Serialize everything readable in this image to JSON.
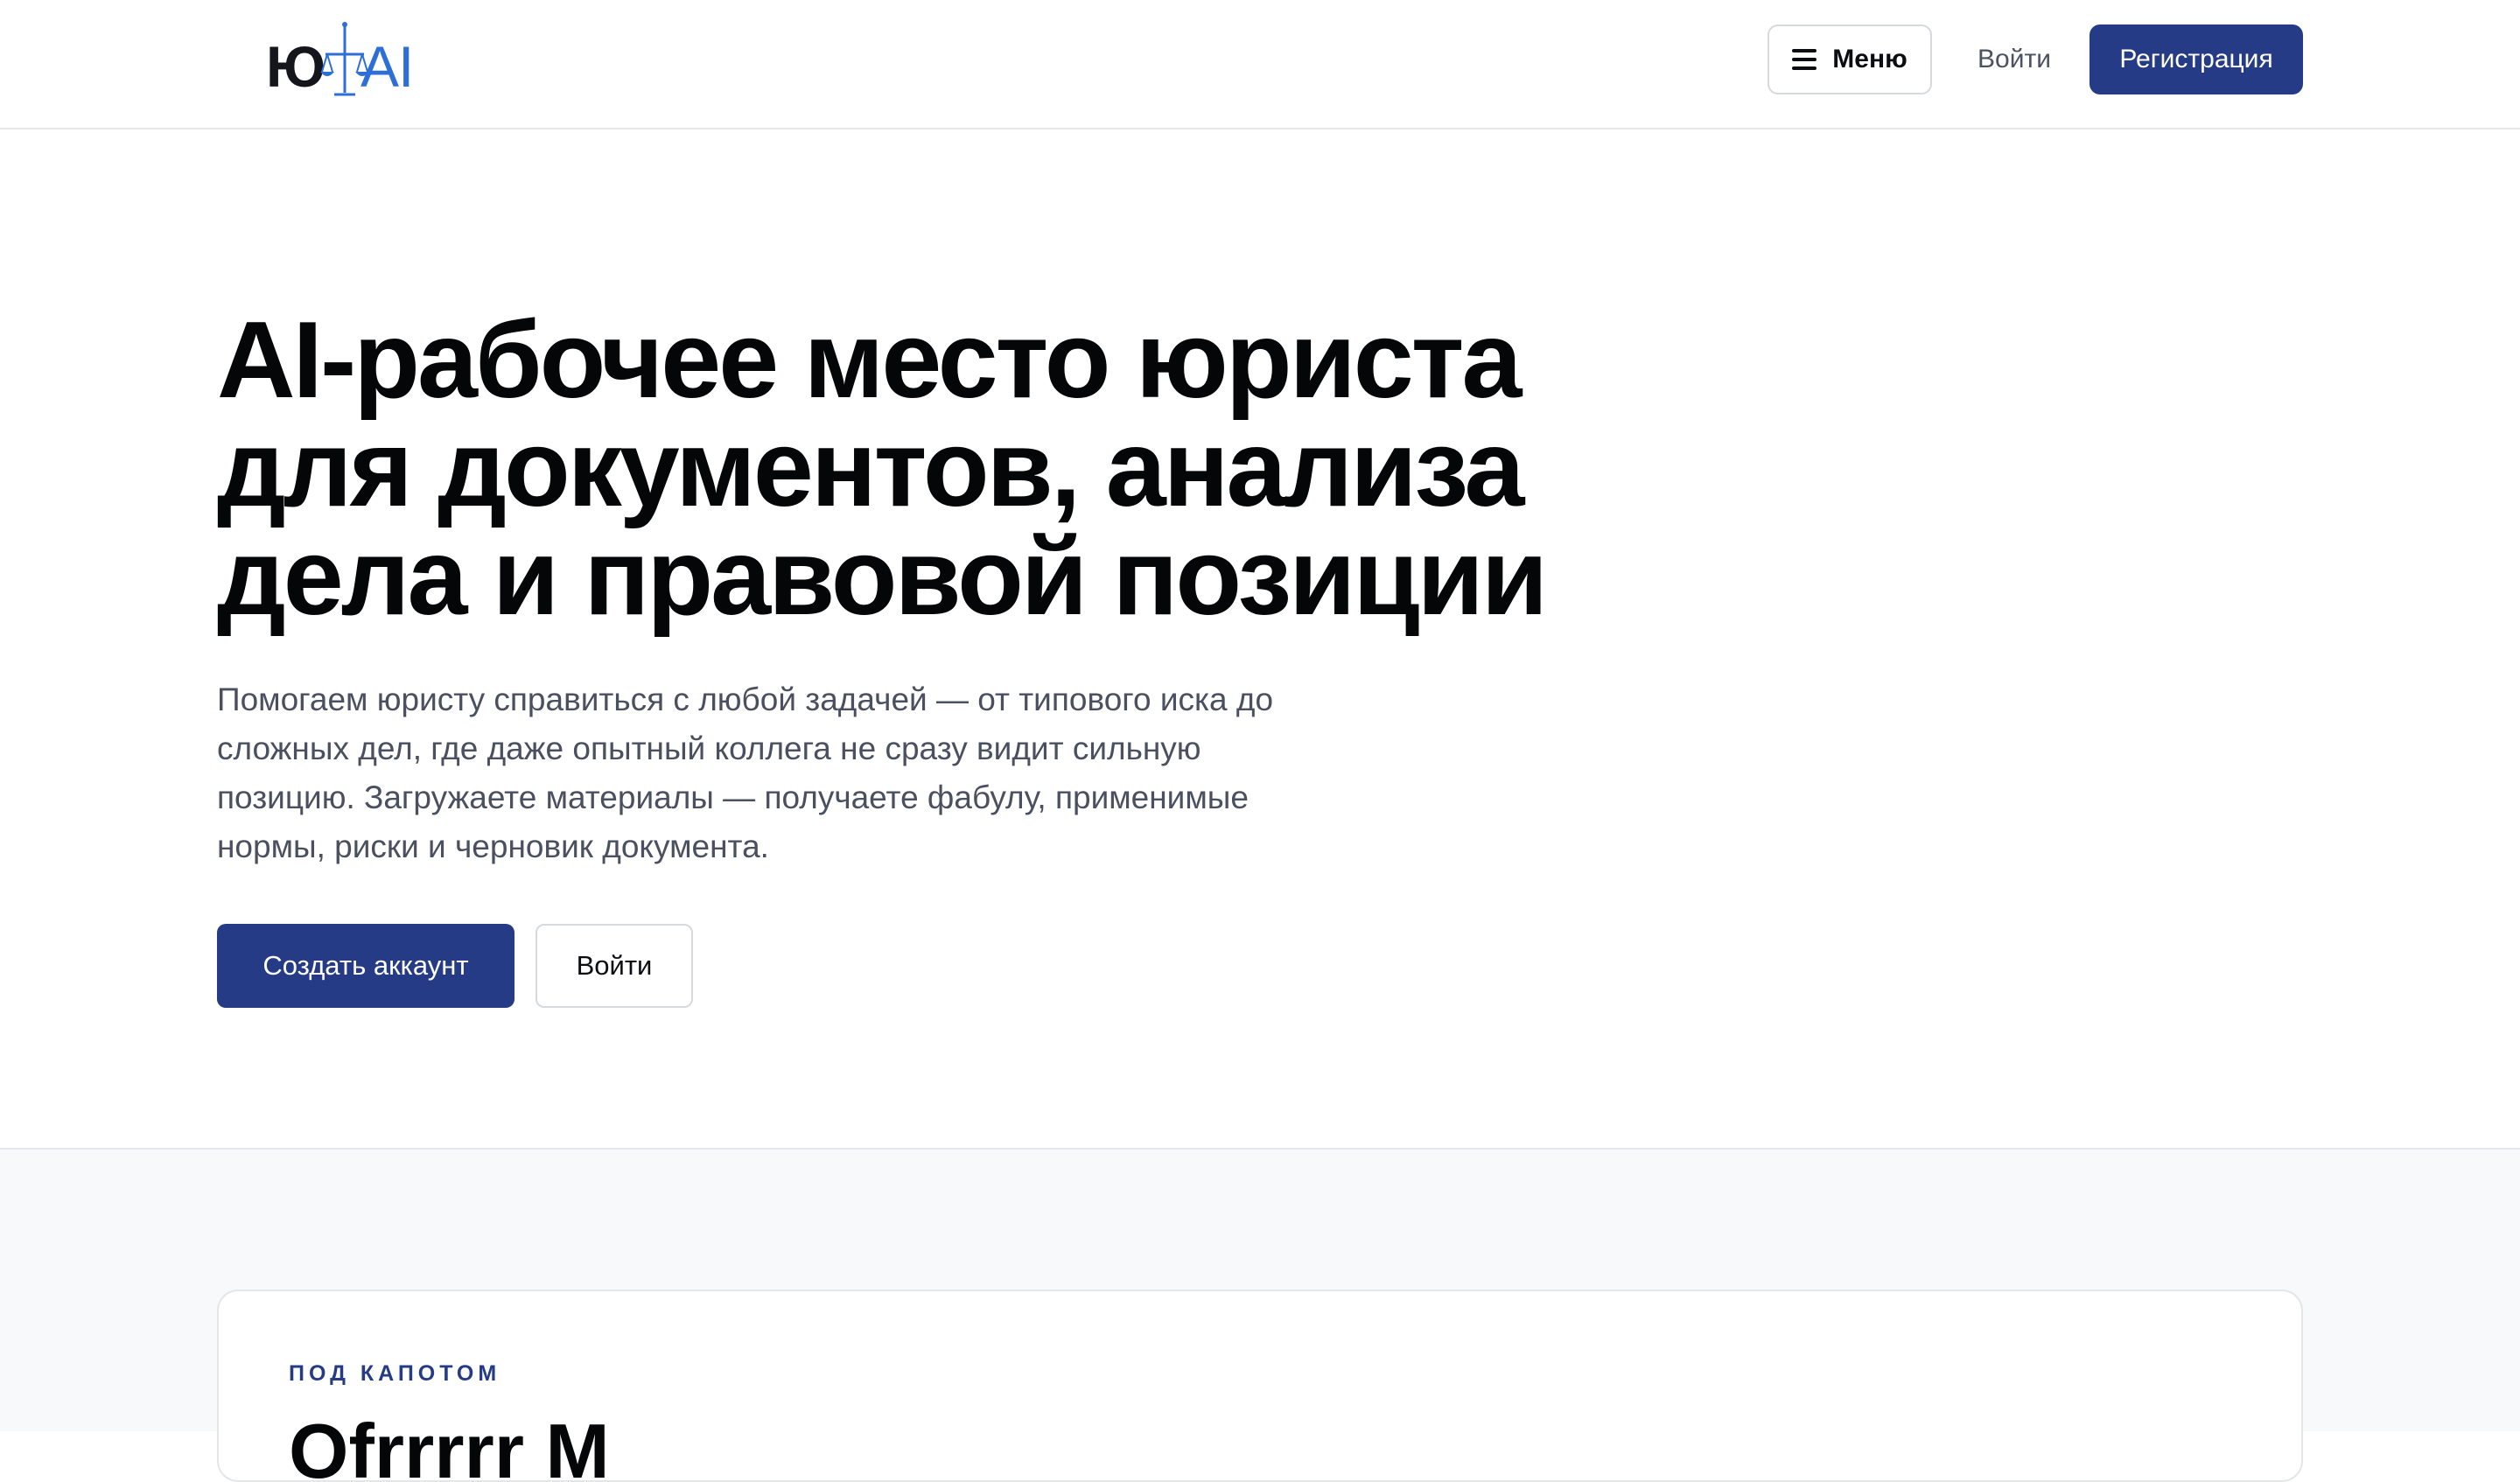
{
  "header": {
    "logo": {
      "text_left": "Ю",
      "text_right": "AI",
      "icon": "scales-icon",
      "brand_color": "#2d6fd6"
    },
    "menu_button": {
      "icon": "hamburger-icon",
      "label": "Меню"
    },
    "login_label": "Войти",
    "register_label": "Регистрация"
  },
  "hero": {
    "title_lines": [
      "AI-рабочее место юриста",
      "для документов, анализа",
      "дела и правовой позиции"
    ],
    "subtitle_lines": [
      "Помогаем юристу справиться с любой задачей — от типового иска до",
      "сложных дел, где даже опытный коллега не сразу видит сильную",
      "позицию. Загружаете материалы — получаете фабулу, применимые",
      "нормы, риски и черновик документа."
    ],
    "primary_button": "Создать аккаунт",
    "secondary_button": "Войти"
  },
  "section": {
    "eyebrow": "ПОД КАПОТОМ",
    "heading": "Ofrrrrr  M"
  },
  "colors": {
    "accent": "#263b86",
    "text_primary": "#050608",
    "text_secondary": "#4a5060",
    "border": "#d6d9de",
    "section_bg": "#f8f9fb"
  }
}
